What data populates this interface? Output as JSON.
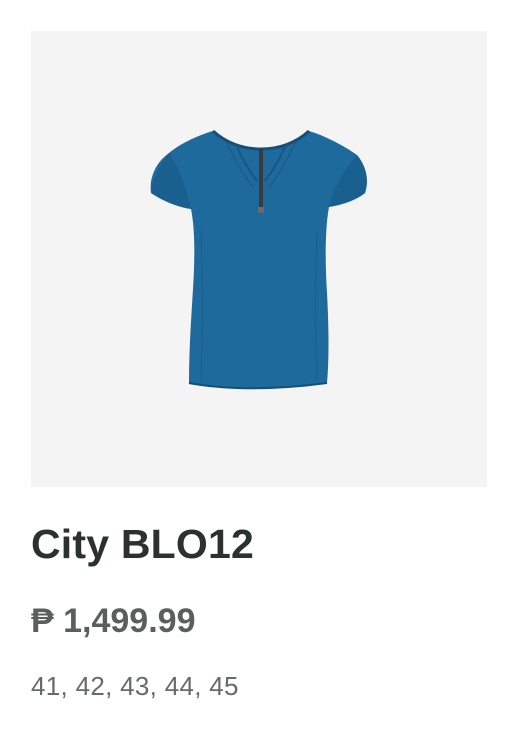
{
  "product": {
    "image_alt": "blue-blouse-icon",
    "name": "City BLO12",
    "price": "₱ 1,499.99",
    "sizes": "41, 42, 43, 44, 45"
  },
  "colors": {
    "image_background": "#f4f4f4",
    "garment": "#1e6a9c",
    "title": "#2b312f",
    "price": "#5a5f5e",
    "sizes": "#666a69"
  }
}
